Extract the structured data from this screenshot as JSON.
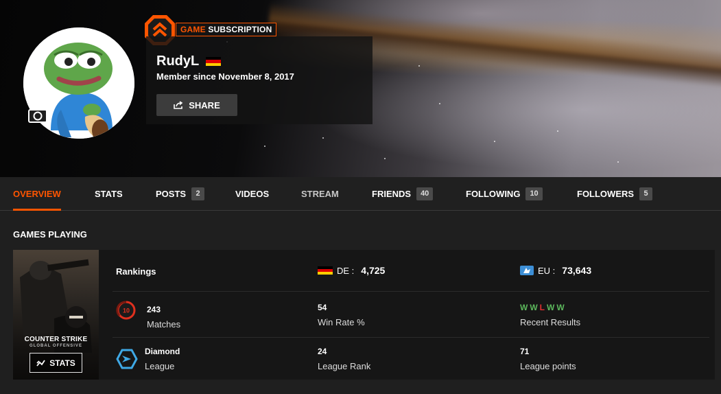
{
  "profile": {
    "subscription_label_accent": "GAME",
    "subscription_label_rest": "SUBSCRIPTION",
    "username": "RudyL",
    "member_since": "Member since November 8, 2017",
    "share_label": "SHARE",
    "country_flag": "germany-flag"
  },
  "tabs": [
    {
      "label": "OVERVIEW",
      "active": true
    },
    {
      "label": "STATS"
    },
    {
      "label": "POSTS",
      "count": "2"
    },
    {
      "label": "VIDEOS"
    },
    {
      "label": "STREAM"
    },
    {
      "label": "FRIENDS",
      "count": "40"
    },
    {
      "label": "FOLLOWING",
      "count": "10"
    },
    {
      "label": "FOLLOWERS",
      "count": "5"
    }
  ],
  "games_playing": {
    "title": "GAMES PLAYING",
    "game": {
      "cover_logo": "COUNTER STRIKE",
      "cover_sublogo": "GLOBAL OFFENSIVE",
      "stats_button": "STATS"
    },
    "rankings": {
      "label": "Rankings",
      "de_region": "DE",
      "de_value": "4,725",
      "eu_region": "EU",
      "eu_value": "73,643"
    },
    "level_badge": "10",
    "matches": {
      "value": "243",
      "label": "Matches"
    },
    "win_rate": {
      "value": "54",
      "label": "Win Rate %"
    },
    "recent_results": {
      "values": [
        "W",
        "W",
        "L",
        "W",
        "W"
      ],
      "label": "Recent Results"
    },
    "league": {
      "value": "Diamond",
      "label": "League"
    },
    "league_rank": {
      "value": "24",
      "label": "League Rank"
    },
    "league_points": {
      "value": "71",
      "label": "League points"
    }
  },
  "colors": {
    "accent": "#ff5500",
    "win": "#5cb85c",
    "loss": "#e03030",
    "level_red": "#e0301e",
    "diamond": "#3fa9e6"
  }
}
